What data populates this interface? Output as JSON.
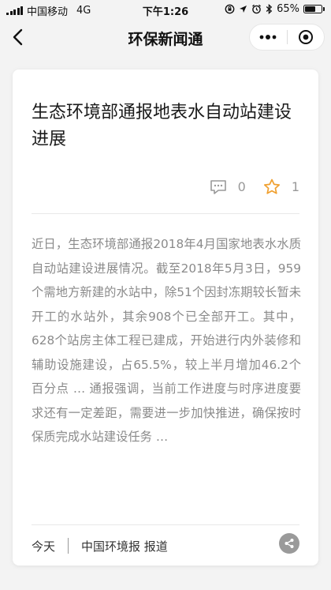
{
  "status_bar": {
    "carrier": "中国移动",
    "network": "4G",
    "time": "下午1:26",
    "battery_percent": "65%",
    "battery_level": 0.65
  },
  "nav": {
    "title": "环保新闻通",
    "back_icon": "chevron-left-icon",
    "more_icon": "more-dots-icon",
    "close_icon": "target-close-icon"
  },
  "article": {
    "title": "生态环境部通报地表水自动站建设进展",
    "comment_count": "0",
    "favorite_count": "1",
    "body": "近日，生态环境部通报2018年4月国家地表水水质自动站建设进展情况。截至2018年5月3日，959个需地方新建的水站中，除51个因封冻期较长暂未开工的水站外，其余908个已全部开工。其中，628个站房主体工程已建成，开始进行内外装修和辅助设施建设，占65.5%，较上半月增加46.2个百分点 … 通报强调，当前工作进度与时序进度要求还有一定差距，需要进一步加快推进，确保按时保质完成水站建设任务 …",
    "date": "今天",
    "source": "中国环境报 报道"
  },
  "colors": {
    "background": "#f3f3f3",
    "card": "#ffffff",
    "favorite_star": "#f0a030",
    "body_text": "#8a8a8a",
    "share_bg": "#9a9a9a"
  }
}
